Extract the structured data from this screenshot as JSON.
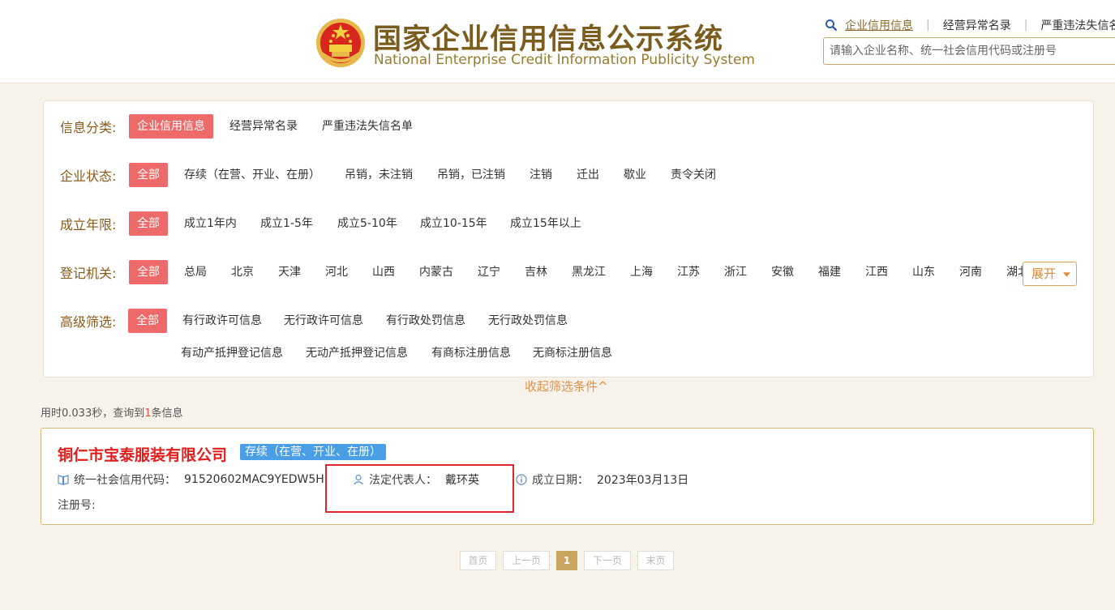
{
  "header": {
    "title_cn": "国家企业信用信息公示系统",
    "title_en": "National Enterprise Credit Information Publicity System",
    "links": [
      "企业信用信息",
      "经营异常名录",
      "严重违法失信名单"
    ],
    "search_placeholder": "请输入企业名称、统一社会信用代码或注册号",
    "search_icon": "search-icon"
  },
  "filters": {
    "category": {
      "label": "信息分类:",
      "options": [
        "企业信用信息",
        "经营异常名录",
        "严重违法失信名单"
      ]
    },
    "status": {
      "label": "企业状态:",
      "options": [
        "全部",
        "存续（在营、开业、在册）",
        "吊销，未注销",
        "吊销，已注销",
        "注销",
        "迁出",
        "歇业",
        "责令关闭"
      ]
    },
    "years": {
      "label": "成立年限:",
      "options": [
        "全部",
        "成立1年内",
        "成立1-5年",
        "成立5-10年",
        "成立10-15年",
        "成立15年以上"
      ]
    },
    "authority": {
      "label": "登记机关:",
      "options": [
        "全部",
        "总局",
        "北京",
        "天津",
        "河北",
        "山西",
        "内蒙古",
        "辽宁",
        "吉林",
        "黑龙江",
        "上海",
        "江苏",
        "浙江",
        "安徽",
        "福建",
        "江西",
        "山东",
        "河南",
        "湖北"
      ]
    },
    "advanced": {
      "label": "高级筛选:",
      "options": [
        "全部",
        "有行政许可信息",
        "无行政许可信息",
        "有行政处罚信息",
        "无行政处罚信息",
        "有动产抵押登记信息",
        "无动产抵押登记信息",
        "有商标注册信息",
        "无商标注册信息"
      ]
    },
    "expand_label": "展开",
    "collapse_label": "收起筛选条件^"
  },
  "stats": {
    "prefix": "用时0.033秒，查询到",
    "count": "1",
    "suffix": "条信息"
  },
  "result": {
    "company_name": "铜仁市宝泰服装有限公司",
    "status": "存续（在营、开业、在册）",
    "credit_code_label": "统一社会信用代码：",
    "credit_code": "91520602MAC9YEDW5H",
    "legal_rep_label": "法定代表人：",
    "legal_rep": "戴环英",
    "est_date_label": "成立日期：",
    "est_date": "2023年03月13日",
    "reg_no_label": "注册号:"
  },
  "pagination": {
    "first": "首页",
    "prev": "上一页",
    "current": "1",
    "next": "下一页",
    "last": "末页"
  },
  "colors": {
    "accent_red": "#ee6a6a",
    "brand_gold": "#7a5c1e",
    "status_blue": "#4a9ee6",
    "company_red": "#e51c1c"
  }
}
